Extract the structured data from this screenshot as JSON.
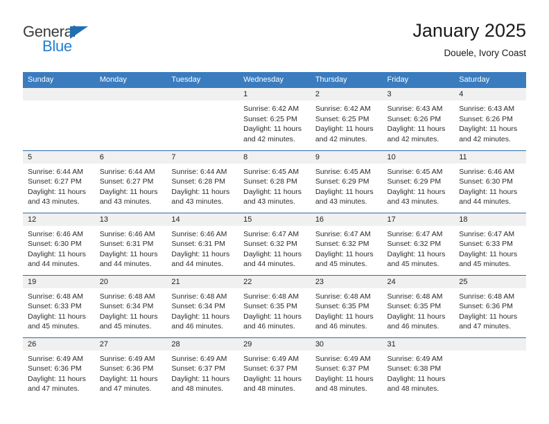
{
  "brand": {
    "name_top": "General",
    "name_bottom": "Blue",
    "triangle_color": "#1f6fb5",
    "blue_text_color": "#1f7fd0"
  },
  "header": {
    "title": "January 2025",
    "subtitle": "Douele, Ivory Coast"
  },
  "theme": {
    "header_row_bg": "#3a7cbe",
    "row_divider": "#2a6ba8",
    "daynum_band_bg": "#f0f0f0"
  },
  "weekday_headers": [
    "Sunday",
    "Monday",
    "Tuesday",
    "Wednesday",
    "Thursday",
    "Friday",
    "Saturday"
  ],
  "weeks": [
    [
      {
        "day": "",
        "blank": true,
        "sunrise": "",
        "sunset": "",
        "daylight_1": "",
        "daylight_2": ""
      },
      {
        "day": "",
        "blank": true,
        "sunrise": "",
        "sunset": "",
        "daylight_1": "",
        "daylight_2": ""
      },
      {
        "day": "",
        "blank": true,
        "sunrise": "",
        "sunset": "",
        "daylight_1": "",
        "daylight_2": ""
      },
      {
        "day": "1",
        "blank": false,
        "sunrise": "Sunrise: 6:42 AM",
        "sunset": "Sunset: 6:25 PM",
        "daylight_1": "Daylight: 11 hours",
        "daylight_2": "and 42 minutes."
      },
      {
        "day": "2",
        "blank": false,
        "sunrise": "Sunrise: 6:42 AM",
        "sunset": "Sunset: 6:25 PM",
        "daylight_1": "Daylight: 11 hours",
        "daylight_2": "and 42 minutes."
      },
      {
        "day": "3",
        "blank": false,
        "sunrise": "Sunrise: 6:43 AM",
        "sunset": "Sunset: 6:26 PM",
        "daylight_1": "Daylight: 11 hours",
        "daylight_2": "and 42 minutes."
      },
      {
        "day": "4",
        "blank": false,
        "sunrise": "Sunrise: 6:43 AM",
        "sunset": "Sunset: 6:26 PM",
        "daylight_1": "Daylight: 11 hours",
        "daylight_2": "and 42 minutes."
      }
    ],
    [
      {
        "day": "5",
        "blank": false,
        "sunrise": "Sunrise: 6:44 AM",
        "sunset": "Sunset: 6:27 PM",
        "daylight_1": "Daylight: 11 hours",
        "daylight_2": "and 43 minutes."
      },
      {
        "day": "6",
        "blank": false,
        "sunrise": "Sunrise: 6:44 AM",
        "sunset": "Sunset: 6:27 PM",
        "daylight_1": "Daylight: 11 hours",
        "daylight_2": "and 43 minutes."
      },
      {
        "day": "7",
        "blank": false,
        "sunrise": "Sunrise: 6:44 AM",
        "sunset": "Sunset: 6:28 PM",
        "daylight_1": "Daylight: 11 hours",
        "daylight_2": "and 43 minutes."
      },
      {
        "day": "8",
        "blank": false,
        "sunrise": "Sunrise: 6:45 AM",
        "sunset": "Sunset: 6:28 PM",
        "daylight_1": "Daylight: 11 hours",
        "daylight_2": "and 43 minutes."
      },
      {
        "day": "9",
        "blank": false,
        "sunrise": "Sunrise: 6:45 AM",
        "sunset": "Sunset: 6:29 PM",
        "daylight_1": "Daylight: 11 hours",
        "daylight_2": "and 43 minutes."
      },
      {
        "day": "10",
        "blank": false,
        "sunrise": "Sunrise: 6:45 AM",
        "sunset": "Sunset: 6:29 PM",
        "daylight_1": "Daylight: 11 hours",
        "daylight_2": "and 43 minutes."
      },
      {
        "day": "11",
        "blank": false,
        "sunrise": "Sunrise: 6:46 AM",
        "sunset": "Sunset: 6:30 PM",
        "daylight_1": "Daylight: 11 hours",
        "daylight_2": "and 44 minutes."
      }
    ],
    [
      {
        "day": "12",
        "blank": false,
        "sunrise": "Sunrise: 6:46 AM",
        "sunset": "Sunset: 6:30 PM",
        "daylight_1": "Daylight: 11 hours",
        "daylight_2": "and 44 minutes."
      },
      {
        "day": "13",
        "blank": false,
        "sunrise": "Sunrise: 6:46 AM",
        "sunset": "Sunset: 6:31 PM",
        "daylight_1": "Daylight: 11 hours",
        "daylight_2": "and 44 minutes."
      },
      {
        "day": "14",
        "blank": false,
        "sunrise": "Sunrise: 6:46 AM",
        "sunset": "Sunset: 6:31 PM",
        "daylight_1": "Daylight: 11 hours",
        "daylight_2": "and 44 minutes."
      },
      {
        "day": "15",
        "blank": false,
        "sunrise": "Sunrise: 6:47 AM",
        "sunset": "Sunset: 6:32 PM",
        "daylight_1": "Daylight: 11 hours",
        "daylight_2": "and 44 minutes."
      },
      {
        "day": "16",
        "blank": false,
        "sunrise": "Sunrise: 6:47 AM",
        "sunset": "Sunset: 6:32 PM",
        "daylight_1": "Daylight: 11 hours",
        "daylight_2": "and 45 minutes."
      },
      {
        "day": "17",
        "blank": false,
        "sunrise": "Sunrise: 6:47 AM",
        "sunset": "Sunset: 6:32 PM",
        "daylight_1": "Daylight: 11 hours",
        "daylight_2": "and 45 minutes."
      },
      {
        "day": "18",
        "blank": false,
        "sunrise": "Sunrise: 6:47 AM",
        "sunset": "Sunset: 6:33 PM",
        "daylight_1": "Daylight: 11 hours",
        "daylight_2": "and 45 minutes."
      }
    ],
    [
      {
        "day": "19",
        "blank": false,
        "sunrise": "Sunrise: 6:48 AM",
        "sunset": "Sunset: 6:33 PM",
        "daylight_1": "Daylight: 11 hours",
        "daylight_2": "and 45 minutes."
      },
      {
        "day": "20",
        "blank": false,
        "sunrise": "Sunrise: 6:48 AM",
        "sunset": "Sunset: 6:34 PM",
        "daylight_1": "Daylight: 11 hours",
        "daylight_2": "and 45 minutes."
      },
      {
        "day": "21",
        "blank": false,
        "sunrise": "Sunrise: 6:48 AM",
        "sunset": "Sunset: 6:34 PM",
        "daylight_1": "Daylight: 11 hours",
        "daylight_2": "and 46 minutes."
      },
      {
        "day": "22",
        "blank": false,
        "sunrise": "Sunrise: 6:48 AM",
        "sunset": "Sunset: 6:35 PM",
        "daylight_1": "Daylight: 11 hours",
        "daylight_2": "and 46 minutes."
      },
      {
        "day": "23",
        "blank": false,
        "sunrise": "Sunrise: 6:48 AM",
        "sunset": "Sunset: 6:35 PM",
        "daylight_1": "Daylight: 11 hours",
        "daylight_2": "and 46 minutes."
      },
      {
        "day": "24",
        "blank": false,
        "sunrise": "Sunrise: 6:48 AM",
        "sunset": "Sunset: 6:35 PM",
        "daylight_1": "Daylight: 11 hours",
        "daylight_2": "and 46 minutes."
      },
      {
        "day": "25",
        "blank": false,
        "sunrise": "Sunrise: 6:48 AM",
        "sunset": "Sunset: 6:36 PM",
        "daylight_1": "Daylight: 11 hours",
        "daylight_2": "and 47 minutes."
      }
    ],
    [
      {
        "day": "26",
        "blank": false,
        "sunrise": "Sunrise: 6:49 AM",
        "sunset": "Sunset: 6:36 PM",
        "daylight_1": "Daylight: 11 hours",
        "daylight_2": "and 47 minutes."
      },
      {
        "day": "27",
        "blank": false,
        "sunrise": "Sunrise: 6:49 AM",
        "sunset": "Sunset: 6:36 PM",
        "daylight_1": "Daylight: 11 hours",
        "daylight_2": "and 47 minutes."
      },
      {
        "day": "28",
        "blank": false,
        "sunrise": "Sunrise: 6:49 AM",
        "sunset": "Sunset: 6:37 PM",
        "daylight_1": "Daylight: 11 hours",
        "daylight_2": "and 48 minutes."
      },
      {
        "day": "29",
        "blank": false,
        "sunrise": "Sunrise: 6:49 AM",
        "sunset": "Sunset: 6:37 PM",
        "daylight_1": "Daylight: 11 hours",
        "daylight_2": "and 48 minutes."
      },
      {
        "day": "30",
        "blank": false,
        "sunrise": "Sunrise: 6:49 AM",
        "sunset": "Sunset: 6:37 PM",
        "daylight_1": "Daylight: 11 hours",
        "daylight_2": "and 48 minutes."
      },
      {
        "day": "31",
        "blank": false,
        "sunrise": "Sunrise: 6:49 AM",
        "sunset": "Sunset: 6:38 PM",
        "daylight_1": "Daylight: 11 hours",
        "daylight_2": "and 48 minutes."
      },
      {
        "day": "",
        "blank": true,
        "sunrise": "",
        "sunset": "",
        "daylight_1": "",
        "daylight_2": ""
      }
    ]
  ]
}
